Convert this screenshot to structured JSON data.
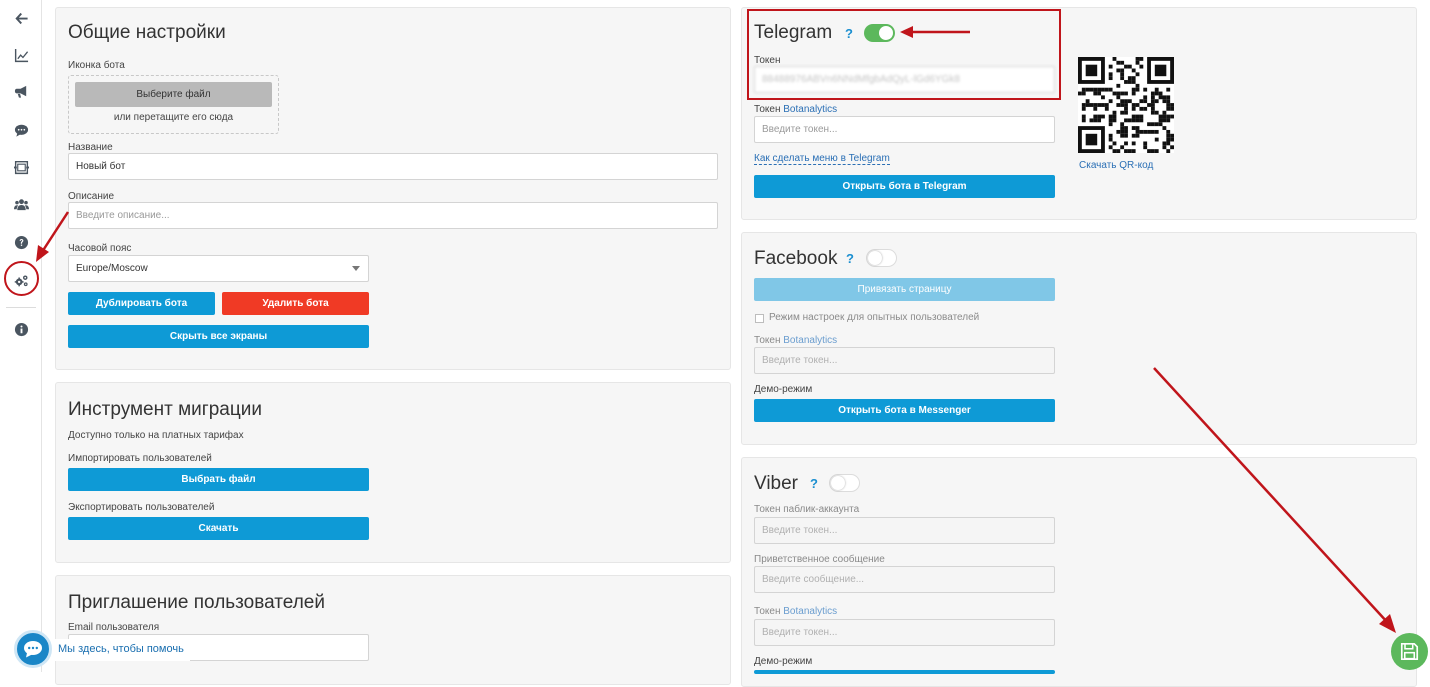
{
  "sidebar": {
    "items": [
      {
        "icon": "arrow-left-icon"
      },
      {
        "icon": "chart-line-icon"
      },
      {
        "icon": "megaphone-icon"
      },
      {
        "icon": "chat-bubble-icon"
      },
      {
        "icon": "screens-icon"
      },
      {
        "icon": "users-icon"
      },
      {
        "icon": "help-icon"
      },
      {
        "icon": "gears-icon"
      },
      {
        "icon": "info-icon"
      }
    ]
  },
  "general": {
    "title": "Общие настройки",
    "icon_label": "Иконка бота",
    "choose_file": "Выберите файл",
    "drag_hint": "или перетащите его сюда",
    "name_label": "Название",
    "name_value": "Новый бот",
    "desc_label": "Описание",
    "desc_placeholder": "Введите описание...",
    "tz_label": "Часовой пояс",
    "tz_value": "Europe/Moscow",
    "duplicate_btn": "Дублировать бота",
    "delete_btn": "Удалить бота",
    "hide_screens_btn": "Скрыть все экраны"
  },
  "migration": {
    "title": "Инструмент миграции",
    "note": "Доступно только на платных тарифах",
    "import_label": "Импортировать пользователей",
    "import_btn": "Выбрать файл",
    "export_label": "Экспортировать пользователей",
    "export_btn": "Скачать"
  },
  "invite": {
    "title": "Приглашение пользователей",
    "email_label": "Email пользователя"
  },
  "telegram": {
    "title": "Telegram",
    "help": "?",
    "enabled": true,
    "token_label": "Токен",
    "token_value": "88488976ABVn6NNdMfgbAdQyL-lGd6YGk8",
    "bot_token_label": "Токен",
    "bot_token_link": "Botanalytics",
    "bot_token_placeholder": "Введите токен...",
    "menu_link": "Как сделать меню в Telegram",
    "open_btn": "Открыть бота в Telegram",
    "qr_link": "Скачать QR-код"
  },
  "facebook": {
    "title": "Facebook",
    "help": "?",
    "enabled": false,
    "bind_btn": "Привязать страницу",
    "expert_mode": "Режим настроек для опытных пользователей",
    "bot_token_label": "Токен",
    "bot_token_link": "Botanalytics",
    "bot_token_placeholder": "Введите токен...",
    "demo_label": "Демо-режим",
    "open_btn": "Открыть бота в Messenger"
  },
  "viber": {
    "title": "Viber",
    "help": "?",
    "enabled": false,
    "public_token_label": "Токен паблик-аккаунта",
    "public_token_placeholder": "Введите токен...",
    "welcome_label": "Приветственное сообщение",
    "welcome_placeholder": "Введите сообщение...",
    "bot_token_label": "Токен",
    "bot_token_link": "Botanalytics",
    "bot_token_placeholder": "Введите токен...",
    "demo_label": "Демо-режим"
  },
  "chat_widget": {
    "text": "Мы здесь, чтобы помочь"
  },
  "colors": {
    "accent_blue": "#0e9ad6",
    "danger_red": "#f03a25",
    "toggle_on": "#5cb85c",
    "annotation_red": "#c0151b",
    "save_green": "#5cb85c"
  }
}
